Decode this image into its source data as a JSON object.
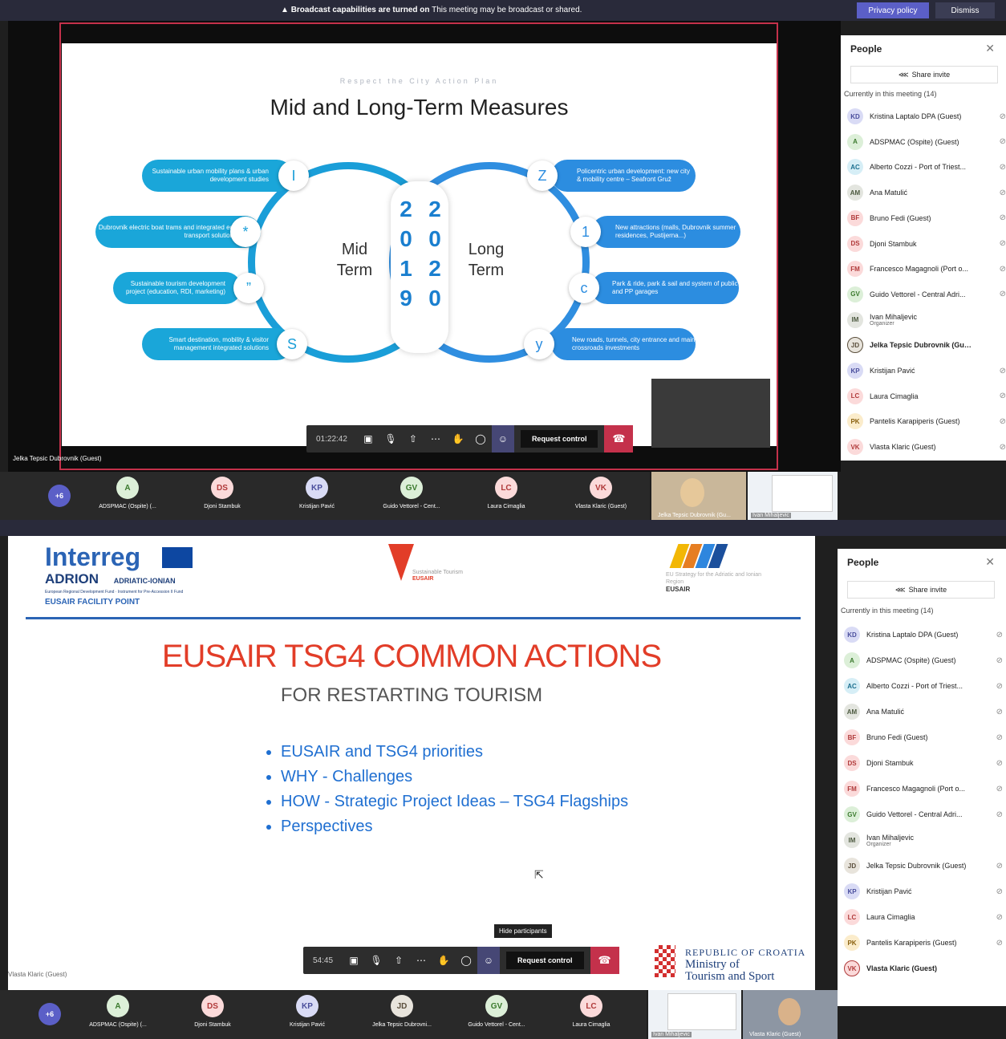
{
  "banner": {
    "icon": "warning-icon",
    "bold": "Broadcast capabilities are turned on",
    "text": " This meeting may be broadcast or shared.",
    "privacy": "Privacy policy",
    "dismiss": "Dismiss"
  },
  "people_panel": {
    "title": "People",
    "share": "Share invite",
    "current": "Currently in this meeting (14)"
  },
  "participants": [
    {
      "init": "KD",
      "name": "Kristina Laptalo DPA (Guest)",
      "color": "#d9dbf5",
      "fg": "#4a4e9c"
    },
    {
      "init": "A",
      "name": "ADSPMAC (Ospite) (Guest)",
      "color": "#dcefd8",
      "fg": "#3b7a2e"
    },
    {
      "init": "AC",
      "name": "Alberto Cozzi - Port of Triest...",
      "color": "#d6eef6",
      "fg": "#1c6f8f"
    },
    {
      "init": "AM",
      "name": "Ana Matulić",
      "color": "#e3e5df",
      "fg": "#4d5a40"
    },
    {
      "init": "BF",
      "name": "Bruno Fedi (Guest)",
      "color": "#fbdada",
      "fg": "#b03a3a"
    },
    {
      "init": "DS",
      "name": "Djoni Stambuk",
      "color": "#fbdada",
      "fg": "#b03a3a"
    },
    {
      "init": "FM",
      "name": "Francesco Magagnoli (Port o...",
      "color": "#fbdada",
      "fg": "#b03a3a"
    },
    {
      "init": "GV",
      "name": "Guido Vettorel - Central Adri...",
      "color": "#dcefd8",
      "fg": "#3b7a2e"
    },
    {
      "init": "IM",
      "name": "Ivan Mihaljevic",
      "sub": "Organizer",
      "color": "#e3e5df",
      "fg": "#4d5a40"
    },
    {
      "init": "JD",
      "name": "Jelka Tepsic Dubrovnik (Guest)",
      "color": "#e8e4dc",
      "fg": "#5b4f3c"
    },
    {
      "init": "KP",
      "name": "Kristijan Pavić",
      "color": "#d9dbf5",
      "fg": "#4a4e9c"
    },
    {
      "init": "LC",
      "name": "Laura Cimaglia",
      "color": "#fbdada",
      "fg": "#b03a3a"
    },
    {
      "init": "PK",
      "name": "Pantelis Karapiperis (Guest)",
      "color": "#fbeccb",
      "fg": "#8a6110"
    },
    {
      "init": "VK",
      "name": "Vlasta Klaric (Guest)",
      "color": "#fbdada",
      "fg": "#b03a3a"
    }
  ],
  "top": {
    "slide": {
      "subtitle": "Respect the City Action Plan",
      "title": "Mid and Long-Term Measures",
      "left_items": [
        "Sustainable urban mobility plans & urban development studies",
        "Dubrovnik electric boat trams and integrated eco transport solutions",
        "Sustainable tourism development project (education, RDI, marketing)",
        "Smart destination, mobility & visitor management integrated solutions"
      ],
      "left_letters": [
        "I",
        "*",
        "”",
        "S"
      ],
      "right_items": [
        "Policentric urban development: new city & mobility centre – Seafront Gruž",
        "New attractions (malls, Dubrovnik summer residences, Pustijerna...)",
        "Park & ride, park & sail and system of public and PP garages",
        "New roads, tunnels, city entrance and main crossroads investments"
      ],
      "right_letters": [
        "Z",
        "1",
        "c",
        "y"
      ],
      "mid": "Mid\nTerm",
      "long": "Long\nTerm",
      "year_left": [
        "2",
        "0",
        "1",
        "9"
      ],
      "year_right": [
        "2",
        "0",
        "2",
        "0"
      ]
    },
    "presenter": "Jelka Tepsic Dubrovnik (Guest)",
    "time": "01:22:42",
    "request": "Request control",
    "strip": [
      {
        "init": "A",
        "name": "ADSPMAC (Ospite) (...",
        "color": "#dcefd8",
        "fg": "#3b7a2e"
      },
      {
        "init": "DS",
        "name": "Djoni Stambuk",
        "color": "#fbdada",
        "fg": "#b03a3a"
      },
      {
        "init": "KP",
        "name": "Kristijan Pavić",
        "color": "#d9dbf5",
        "fg": "#4a4e9c"
      },
      {
        "init": "GV",
        "name": "Guido Vettorel - Cent...",
        "color": "#dcefd8",
        "fg": "#3b7a2e"
      },
      {
        "init": "LC",
        "name": "Laura Cimaglia",
        "color": "#fbdada",
        "fg": "#b03a3a"
      },
      {
        "init": "VK",
        "name": "Vlasta Klaric (Guest)",
        "color": "#fbdada",
        "fg": "#b03a3a"
      }
    ],
    "plus": "+6",
    "video1_name": "Jelka Tepsic Dubrovnik (Gu...",
    "video2_name": "Ivan Mihaljevic"
  },
  "bottom": {
    "slide": {
      "logo1": "Interreg",
      "logo1b": "ADRION",
      "logo1c": "ADRIATIC-IONIAN",
      "logo1d": "European Regional Development Fund · Instrument for Pre-Accession II Fund",
      "logo1e": "EUSAIR FACILITY POINT",
      "logo2a": "Sustainable Tourism",
      "logo2b": "EUSAIR",
      "logo3a": "EU Strategy for the Adriatic and Ionian Region",
      "logo3b": "EUSAIR",
      "title": "EUSAIR TSG4 COMMON ACTIONS",
      "subtitle": "FOR RESTARTING  TOURISM",
      "bullets": [
        "EUSAIR and TSG4 priorities",
        "WHY - Challenges",
        "HOW - Strategic Project Ideas – TSG4 Flagships",
        "Perspectives"
      ],
      "footer1": "REPUBLIC OF CROATIA",
      "footer2": "Ministry of",
      "footer3": "Tourism and Sport"
    },
    "presenter": "Vlasta Klaric (Guest)",
    "time": "54:45",
    "tooltip": "Hide participants",
    "request": "Request control",
    "strip": [
      {
        "init": "A",
        "name": "ADSPMAC (Ospite) (...",
        "color": "#dcefd8",
        "fg": "#3b7a2e"
      },
      {
        "init": "DS",
        "name": "Djoni Stambuk",
        "color": "#fbdada",
        "fg": "#b03a3a"
      },
      {
        "init": "KP",
        "name": "Kristijan Pavić",
        "color": "#d9dbf5",
        "fg": "#4a4e9c"
      },
      {
        "init": "JD",
        "name": "Jelka Tepsic Dubrovni...",
        "color": "#e8e4dc",
        "fg": "#5b4f3c"
      },
      {
        "init": "GV",
        "name": "Guido Vettorel - Cent...",
        "color": "#dcefd8",
        "fg": "#3b7a2e"
      },
      {
        "init": "LC",
        "name": "Laura Cimaglia",
        "color": "#fbdada",
        "fg": "#b03a3a"
      }
    ],
    "plus": "+6",
    "video1_name": "Ivan Mihaljevic",
    "video2_name": "Vlasta Klaric (Guest)"
  }
}
